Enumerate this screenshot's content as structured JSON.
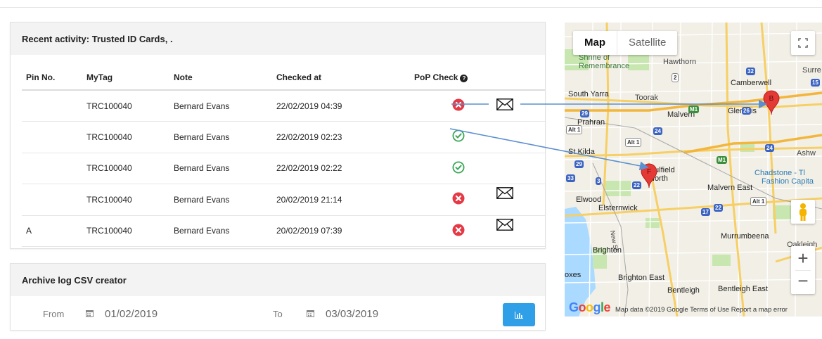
{
  "activity": {
    "title": "Recent activity: Trusted ID Cards, .",
    "columns": {
      "pin": "Pin No.",
      "tag": "MyTag",
      "note": "Note",
      "checked": "Checked at",
      "pop": "PoP Check",
      "pop_help": "?"
    },
    "rows": [
      {
        "pin": "",
        "tag": "TRC100040",
        "note": "Bernard Evans",
        "checked": "22/02/2019 04:39",
        "status": "fail",
        "envelope": true
      },
      {
        "pin": "",
        "tag": "TRC100040",
        "note": "Bernard Evans",
        "checked": "22/02/2019 02:23",
        "status": "pass",
        "envelope": false
      },
      {
        "pin": "",
        "tag": "TRC100040",
        "note": "Bernard Evans",
        "checked": "22/02/2019 02:22",
        "status": "pass",
        "envelope": false
      },
      {
        "pin": "",
        "tag": "TRC100040",
        "note": "Bernard Evans",
        "checked": "20/02/2019 21:14",
        "status": "fail",
        "envelope": true
      },
      {
        "pin": "A",
        "tag": "TRC100040",
        "note": "Bernard Evans",
        "checked": "20/02/2019 07:39",
        "status": "fail",
        "envelope": true
      }
    ]
  },
  "archive": {
    "title": "Archive log CSV creator",
    "from_label": "From",
    "from_value": "01/02/2019",
    "to_label": "To",
    "to_value": "03/03/2019",
    "icons": {
      "calendar": "calendar-icon",
      "chart": "bar-chart-icon"
    }
  },
  "map": {
    "tabs": [
      "Map",
      "Satellite"
    ],
    "active_tab": "Map",
    "markers": [
      {
        "label": "B"
      },
      {
        "label": "F"
      }
    ],
    "place_labels": [
      "Shrine of",
      "Remembrance",
      "Hawthorn",
      "Surre",
      "Camberwell",
      "South Yarra",
      "Toorak",
      "Prahran",
      "Malvern",
      "Glen Iris",
      "St Kilda",
      "Caulfield",
      "North",
      "Ashw",
      "Chadstone - Tl",
      "Fashion Capita",
      "Malvern East",
      "Elwood",
      "Elsternwick",
      "New St",
      "Murrumbeena",
      "Oakleigh",
      "Brighton",
      "oxes",
      "Brighton East",
      "Bentleigh",
      "Bentleigh East"
    ],
    "road_shields": [
      "32",
      "2",
      "15",
      "M1",
      "26",
      "29",
      "Alt 1",
      "24",
      "Alt 1",
      "24",
      "M1",
      "29",
      "33",
      "3",
      "22",
      "Alt 1",
      "17",
      "22"
    ],
    "google": "Google",
    "attribution": "Map data ©2019 Google   Terms of Use   Report a map error",
    "zoom_in": "+",
    "zoom_out": "−",
    "colors": {
      "marker": "#e53935",
      "water": "#aadaff",
      "park": "#c8e6b0",
      "major_road": "#f6cf65",
      "road": "#ffffff"
    }
  },
  "colors": {
    "link": "#3a8fd1",
    "fail": "#e53945",
    "pass": "#3aa757",
    "button": "#2f9fe8",
    "arrow": "#5b8fd0"
  }
}
